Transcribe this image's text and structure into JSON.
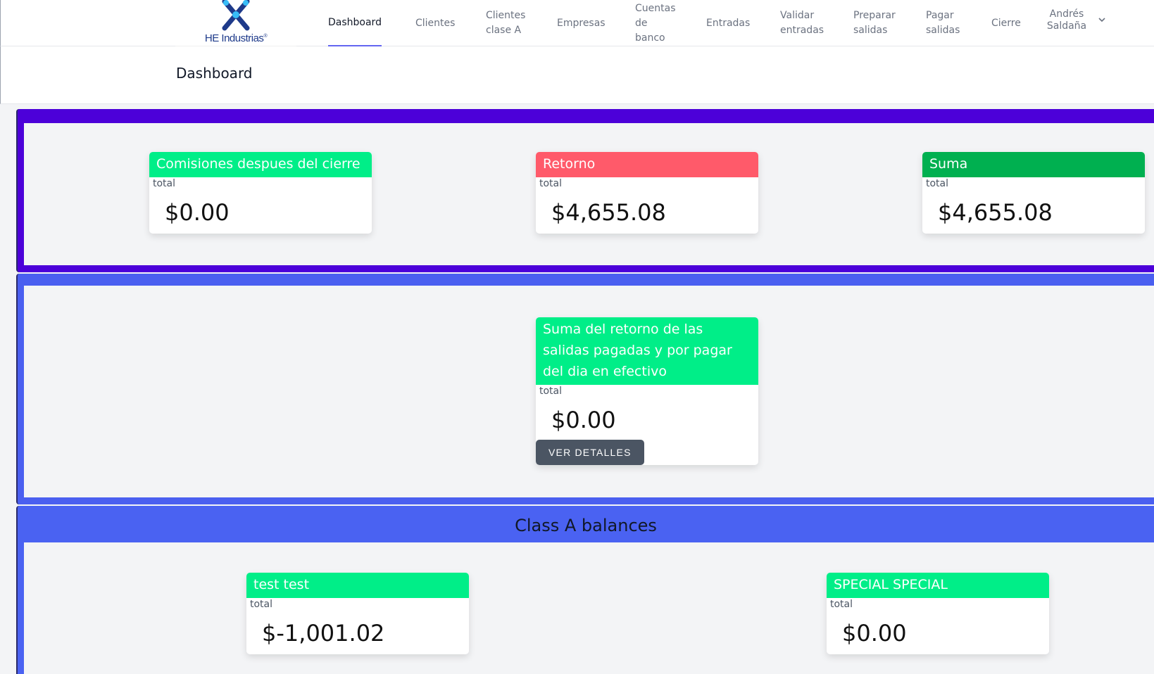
{
  "nav": {
    "logo_text": "HE Industrias",
    "items": [
      {
        "label": "Dashboard",
        "active": true
      },
      {
        "label": "Clientes"
      },
      {
        "label": "Clientes clase A"
      },
      {
        "label": "Empresas"
      },
      {
        "label": "Cuentas de banco"
      },
      {
        "label": "Entradas"
      },
      {
        "label": "Validar entradas"
      },
      {
        "label": "Preparar salidas"
      },
      {
        "label": "Pagar salidas"
      },
      {
        "label": "Cierre"
      }
    ],
    "user_name": "Andrés Saldaña"
  },
  "header": {
    "title": "Dashboard"
  },
  "panel1": {
    "cards": [
      {
        "title": "Comisiones despues del cierre",
        "sub": "total",
        "value": "$0.00",
        "color": "#00ee88"
      },
      {
        "title": "Retorno",
        "sub": "total",
        "value": "$4,655.08",
        "color": "#ff5a6a"
      },
      {
        "title": "Suma",
        "sub": "total",
        "value": "$4,655.08",
        "color": "#00b050"
      }
    ]
  },
  "panel2": {
    "card": {
      "title": "Suma del retorno de las salidas pagadas y por pagar del dia en efectivo",
      "sub": "total",
      "value": "$0.00",
      "button": "VER DETALLES",
      "color": "#00ee88"
    }
  },
  "panel3": {
    "title": "Class A balances",
    "cards": [
      {
        "title": "test test",
        "sub": "total",
        "value": "$-1,001.02",
        "color": "#00ee88"
      },
      {
        "title": "SPECIAL SPECIAL",
        "sub": "total",
        "value": "$0.00",
        "color": "#00ee88"
      }
    ]
  }
}
